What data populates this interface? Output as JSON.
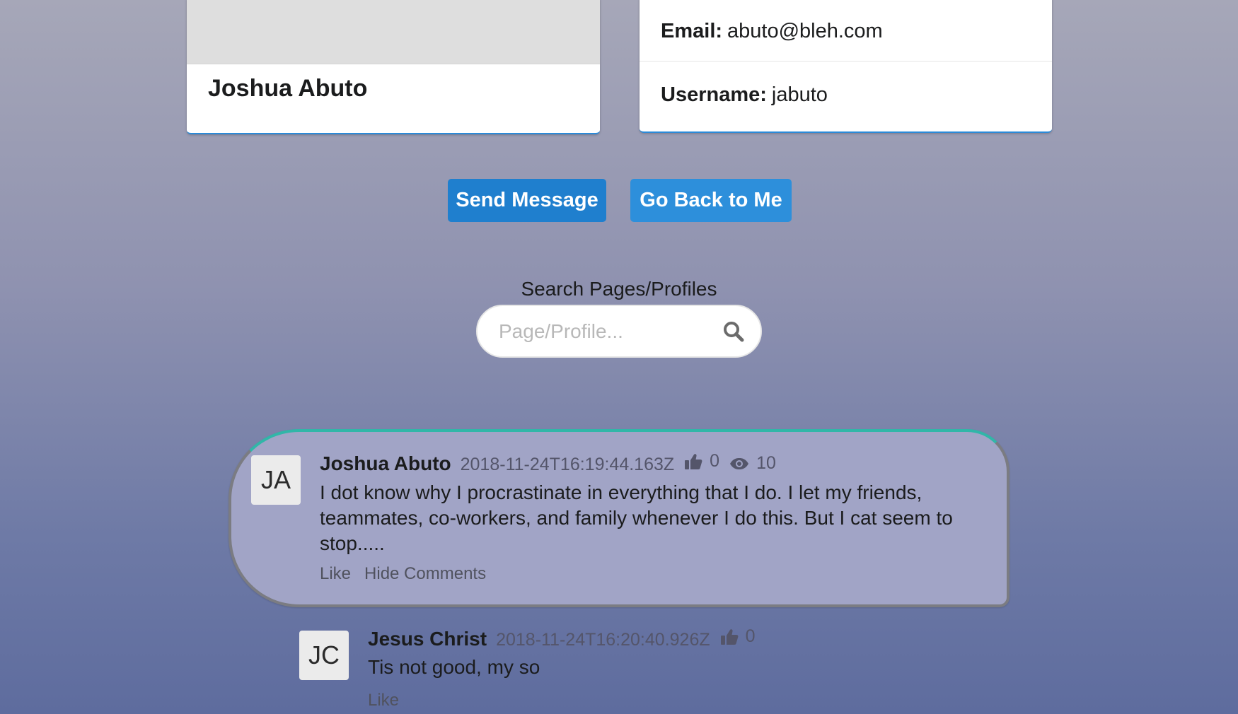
{
  "profile": {
    "name": "Joshua Abuto",
    "email_label": "Email:",
    "email": "abuto@bleh.com",
    "username_label": "Username:",
    "username": "jabuto"
  },
  "buttons": {
    "send_message": "Send Message",
    "go_back": "Go Back to Me"
  },
  "search": {
    "label": "Search Pages/Profiles",
    "placeholder": "Page/Profile...",
    "value": ""
  },
  "comments": [
    {
      "initials": "JA",
      "author": "Joshua Abuto",
      "timestamp": "2018-11-24T16:19:44.163Z",
      "likes": "0",
      "views": "10",
      "text": "I dot know why I procrastinate in everything that I do. I let my friends, teammates, co-workers, and family whenever I do this. But I cat seem to stop.....",
      "actions": [
        "Like",
        "Hide Comments"
      ]
    },
    {
      "initials": "JC",
      "author": "Jesus Christ",
      "timestamp": "2018-11-24T16:20:40.926Z",
      "likes": "0",
      "text": "Tis not good, my so",
      "actions": [
        "Like"
      ]
    }
  ],
  "icons": {
    "like": "thumbs-up-icon",
    "views": "eye-icon",
    "search": "search-icon"
  },
  "colors": {
    "primary_button": "#1f7fce",
    "secondary_button": "#2d8fdb",
    "comment_bg": "#a1a4c6",
    "comment_accent": "#31b6a8"
  }
}
